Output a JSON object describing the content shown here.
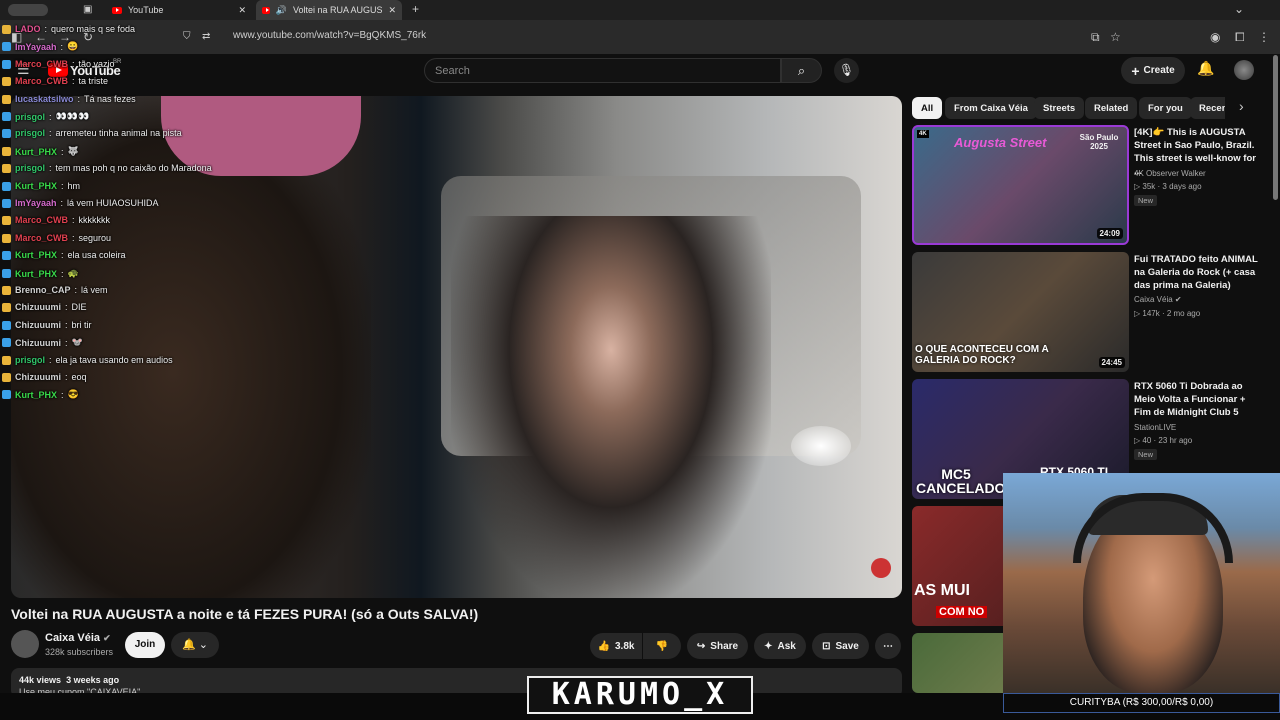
{
  "browser": {
    "tabs": [
      {
        "label": "YouTube"
      },
      {
        "label": "Voltei na RUA AUGUSTA a n"
      }
    ],
    "url": "www.youtube.com/watch?v=BgQKMS_76rk"
  },
  "header": {
    "logo": "YouTube",
    "region": "BR",
    "search_placeholder": "Search",
    "create_label": "Create"
  },
  "chat": [
    {
      "user": "LADO",
      "message": "quero mais q se foda",
      "color": "#e0518f"
    },
    {
      "user": "ImYayaah",
      "message": "😀",
      "color": "#d46acb"
    },
    {
      "user": "Marco_CWB",
      "message": "tão vazio",
      "color": "#e0404f"
    },
    {
      "user": "Marco_CWB",
      "message": "ta triste",
      "color": "#e0404f"
    },
    {
      "user": "lucaskatsilwo",
      "message": "Tá nas fezes",
      "color": "#8a8ad6"
    },
    {
      "user": "prisgol",
      "message": "👀👀👀",
      "color": "#31c76a"
    },
    {
      "user": "prisgol",
      "message": "arremeteu tinha animal na pista",
      "color": "#31c76a"
    },
    {
      "user": "Kurt_PHX",
      "message": "🐺",
      "color": "#39d94a"
    },
    {
      "user": "prisgol",
      "message": "tem mas poh q no caixão do Maradona",
      "color": "#31c76a"
    },
    {
      "user": "Kurt_PHX",
      "message": "hm",
      "color": "#39d94a"
    },
    {
      "user": "ImYayaah",
      "message": "lá vem HUIAOSUHIDA",
      "color": "#d46acb"
    },
    {
      "user": "Marco_CWB",
      "message": "kkkkkkk",
      "color": "#e0404f"
    },
    {
      "user": "Marco_CWB",
      "message": "segurou",
      "color": "#e0404f"
    },
    {
      "user": "Kurt_PHX",
      "message": "ela usa coleira",
      "color": "#39d94a"
    },
    {
      "user": "Kurt_PHX",
      "message": "🐢",
      "color": "#39d94a"
    },
    {
      "user": "Brenno_CAP",
      "message": "lá vem",
      "color": "#d4d4d4"
    },
    {
      "user": "Chizuuumi",
      "message": "DIE",
      "color": "#d4d4d4"
    },
    {
      "user": "Chizuuumi",
      "message": "bri tir",
      "color": "#d4d4d4"
    },
    {
      "user": "Chizuuumi",
      "message": "🐭",
      "color": "#d4d4d4"
    },
    {
      "user": "prisgol",
      "message": "ela ja tava usando em audios",
      "color": "#31c76a"
    },
    {
      "user": "Chizuuumi",
      "message": "eoq",
      "color": "#d4d4d4"
    },
    {
      "user": "Kurt_PHX",
      "message": "😎",
      "color": "#39d94a"
    }
  ],
  "video": {
    "title": "Voltei na RUA AUGUSTA a noite e tá FEZES PURA! (só a Outs SALVA!)",
    "channel": "Caixa Véia",
    "subscribers": "328k subscribers",
    "join_label": "Join",
    "likes": "3.8k",
    "share_label": "Share",
    "ask_label": "Ask",
    "save_label": "Save",
    "views": "44k views",
    "date": "3 weeks ago",
    "description": "Use meu cupom \"CAIXAVEIA\""
  },
  "chips": [
    "All",
    "From Caixa Véia",
    "Streets",
    "Related",
    "For you",
    "Recen"
  ],
  "recommendations": [
    {
      "title": "[4K]👉 This is AUGUSTA Street in Sao Paulo, Brazil. This street is well-know for ...",
      "channel": "4K Observer Walker",
      "meta": "35k · 3 days ago",
      "badge": "New",
      "duration": "24:09",
      "thumb_text": "Augusta Street",
      "thumb_text2": "São Paulo 2025"
    },
    {
      "title": "Fui TRATADO feito ANIMAL na Galeria do Rock (+ casa das prima na Galeria)",
      "channel": "Caixa Véia",
      "meta": "147k · 2 mo ago",
      "duration": "24:45",
      "thumb_text": "O QUE ACONTECEU COM A GALERIA DO ROCK?"
    },
    {
      "title": "RTX 5060 Ti Dobrada ao Meio Volta a Funcionar + Fim de Midnight Club 5",
      "channel": "StationLIVE",
      "meta": "40 · 23 hr ago",
      "badge": "New",
      "thumb_text": "MC5 CANCELADO",
      "thumb_text2": "RTX 5060 TI"
    },
    {
      "thumb_text": "AS MUI",
      "thumb_text2": "COM NO"
    }
  ],
  "overlay": {
    "streamer_name": "KARUMO_X",
    "ticker": "CURITYBA (R$ 300,00/R$ 0,00)"
  }
}
